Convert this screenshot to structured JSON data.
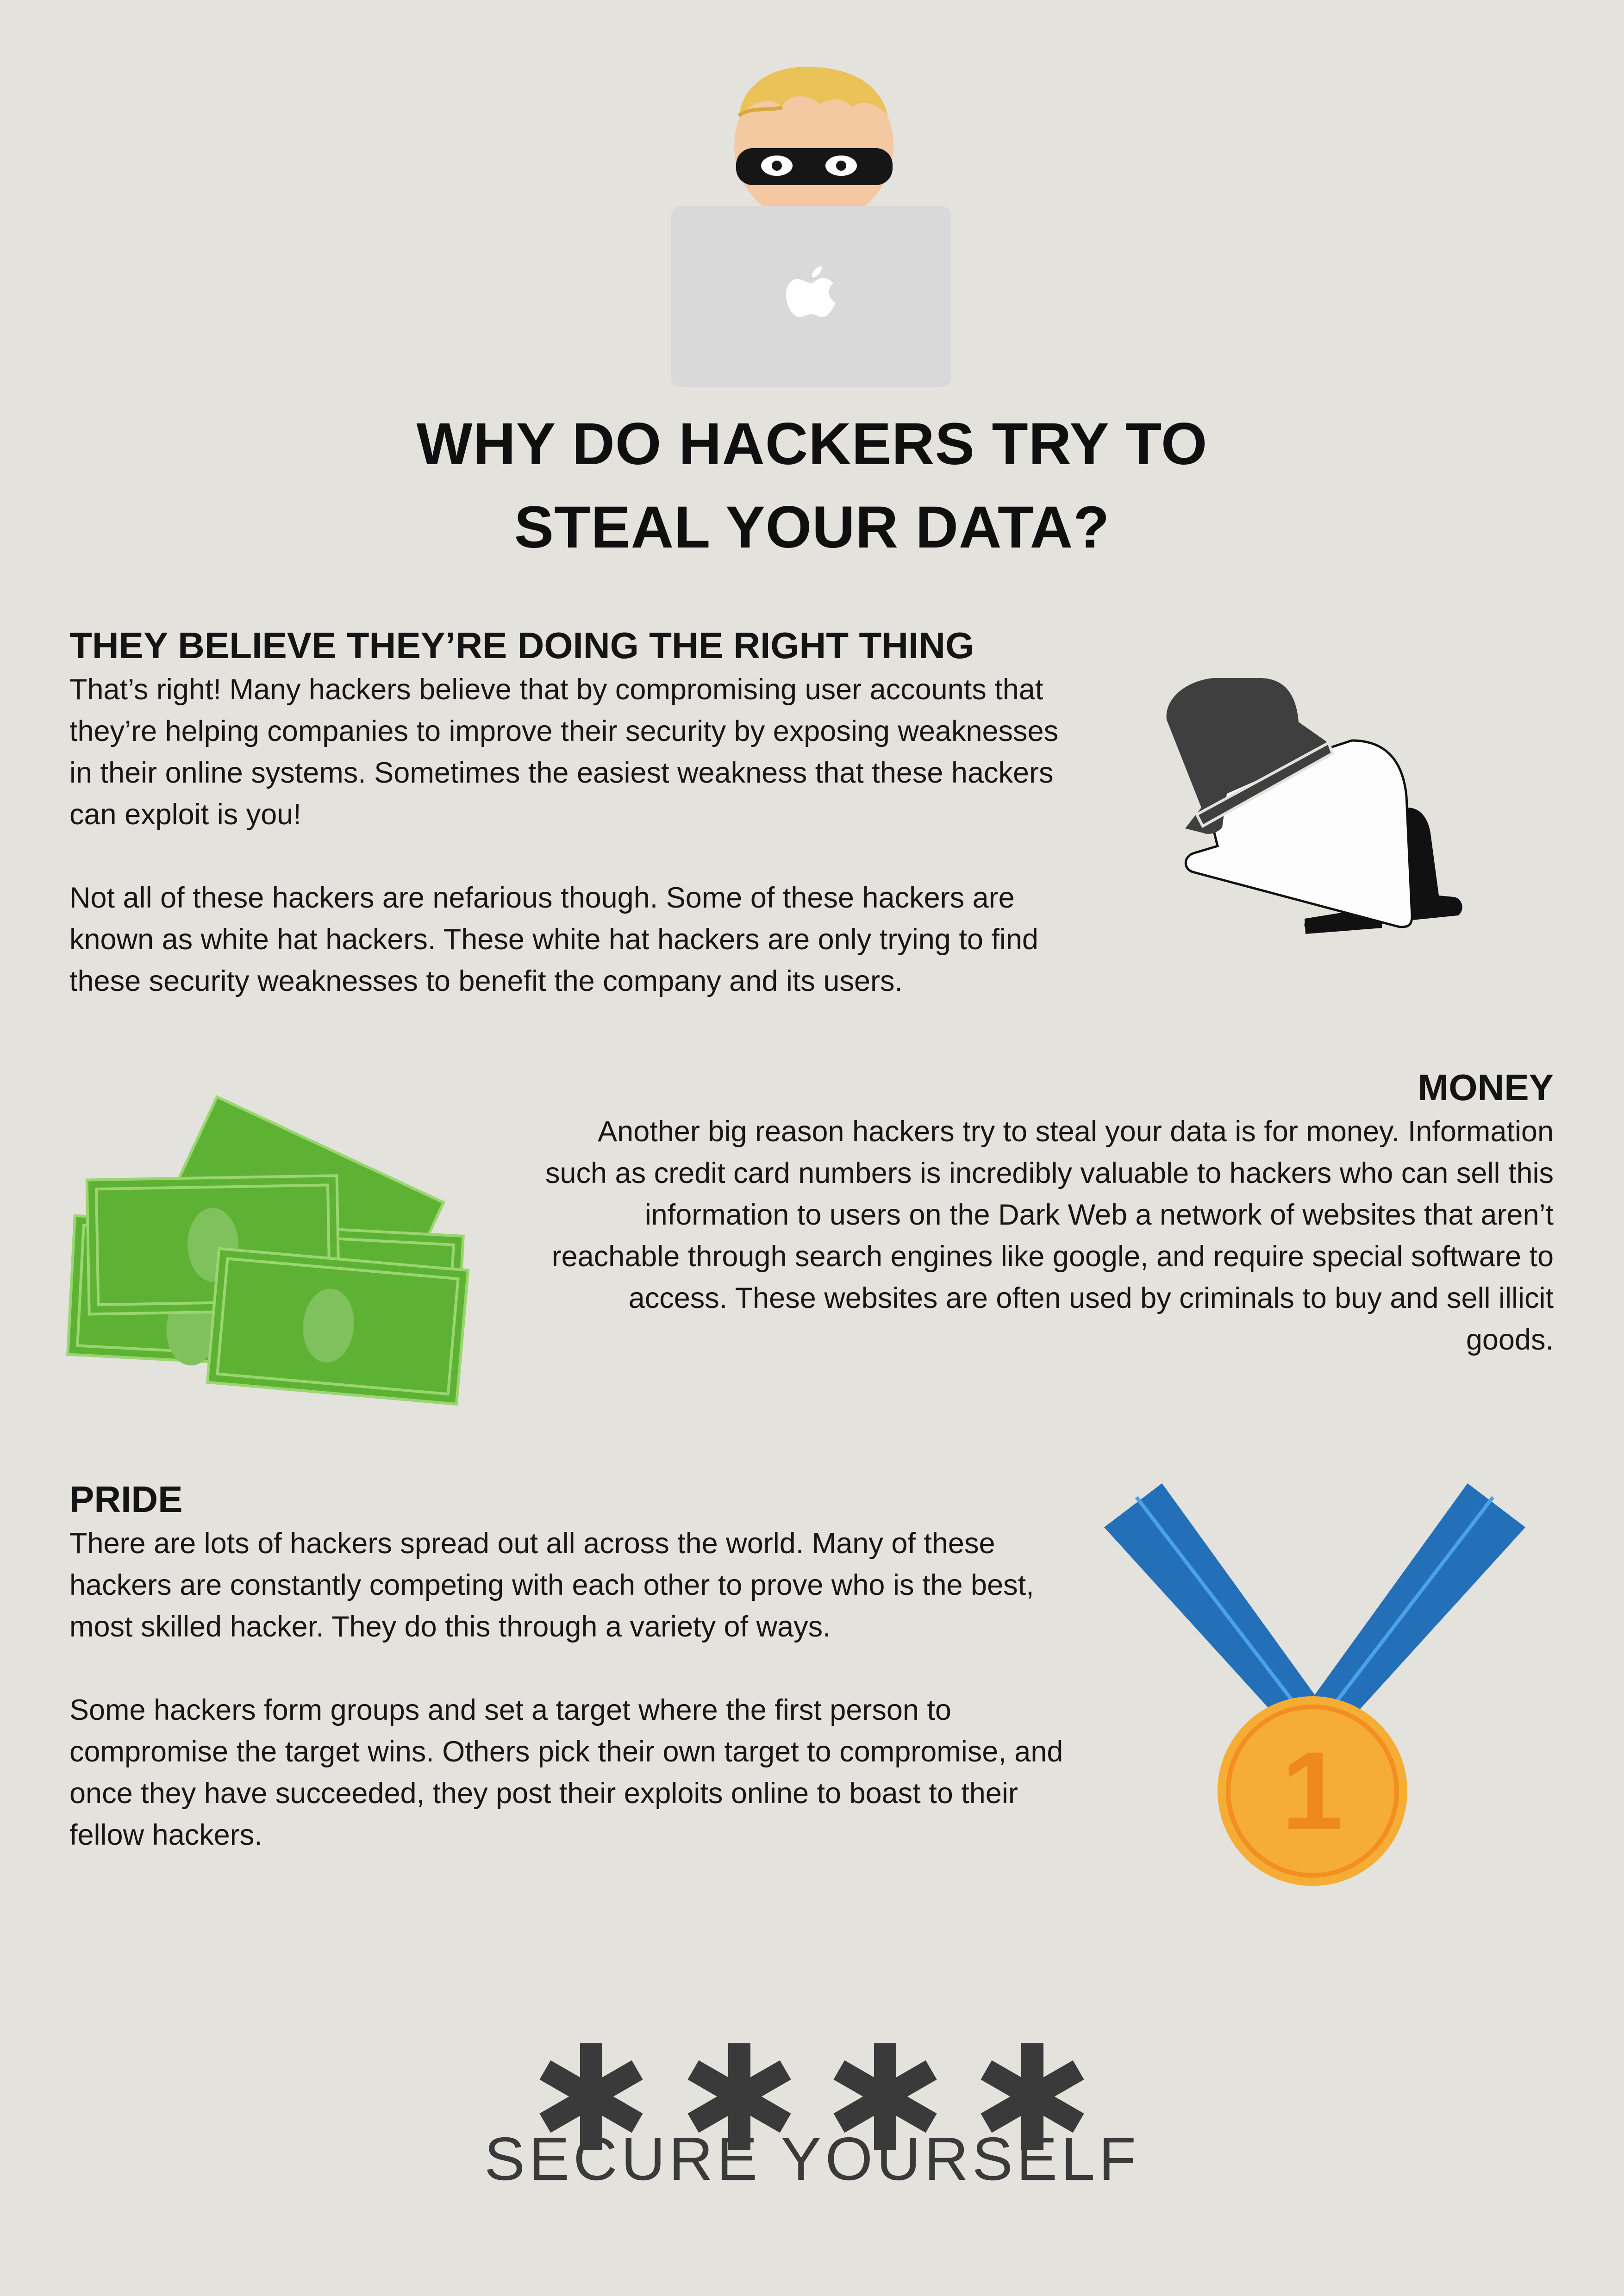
{
  "title": {
    "line1": "WHY DO HACKERS TRY TO",
    "line2": "STEAL YOUR DATA?"
  },
  "sections": [
    {
      "heading": "THEY BELIEVE THEY’RE DOING THE RIGHT THING",
      "paragraphs": [
        "That’s right! Many hackers believe that by compromising user accounts that they’re helping companies to improve their security by exposing weaknesses in their online systems. Sometimes the easiest weakness that these hackers can exploit is you!",
        "Not all of these hackers are nefarious though. Some of these hackers are known as white hat hackers. These white hat hackers are only trying to find these security weaknesses to benefit the company and its users."
      ]
    },
    {
      "heading": "MONEY",
      "paragraphs": [
        "Another big reason hackers try to steal your data is for money. Information such as credit card numbers is incredibly valuable to hackers who can sell this information to users on the Dark Web a network of websites that aren’t reachable through search engines like google, and require special software to access. These websites are often used by criminals to buy and sell illicit goods."
      ]
    },
    {
      "heading": "PRIDE",
      "paragraphs": [
        "There are lots of hackers spread out all across the world. Many of these hackers are constantly competing with each other to prove who is the best, most skilled hacker. They do this through a variety of ways.",
        "Some hackers form groups and set a target where the first person to compromise the target wins. Others pick their own target to compromise, and once they have succeeded, they post their exploits online to boast to their fellow hackers."
      ]
    }
  ],
  "medal": {
    "number": "1"
  },
  "footer": {
    "text": "SECURE YOURSELF"
  },
  "icons": [
    "hacker-illustration",
    "laptop-icon",
    "apple-logo-icon",
    "fallen-hat-icon",
    "money-icon",
    "medal-icon",
    "asterisk-icon"
  ],
  "colors": {
    "background": "#e3e2dc",
    "money_green": "#5db233",
    "ribbon_blue": "#2470b8",
    "medal_gold": "#f6ad36",
    "medal_number": "#ee8a1c",
    "hat_dark": "#3f3f3f"
  }
}
